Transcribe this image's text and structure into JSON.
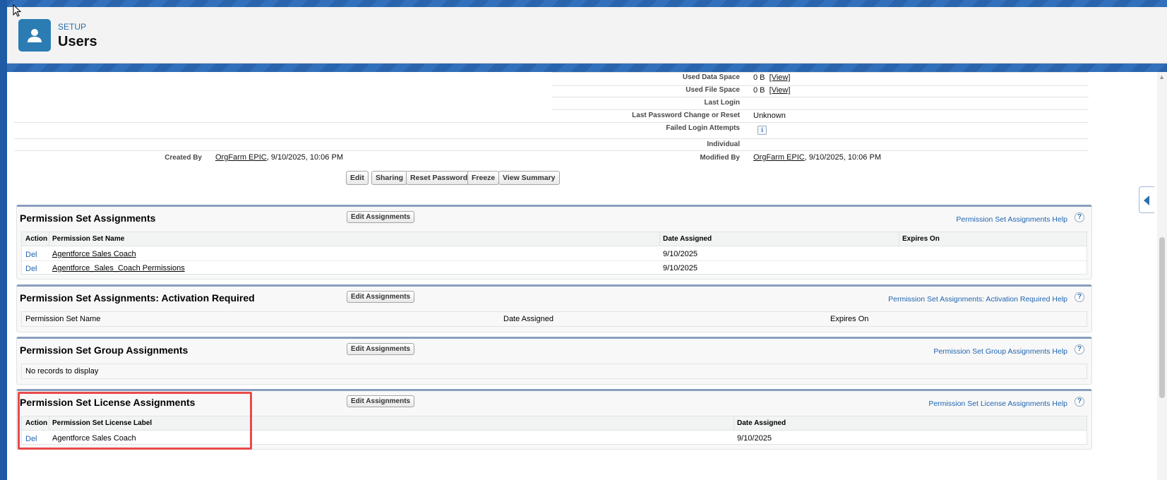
{
  "header": {
    "breadcrumb": "SETUP",
    "title": "Users"
  },
  "details": {
    "used_data_space": {
      "label": "Used Data Space",
      "value": "0 B",
      "link": "[View]"
    },
    "used_file_space": {
      "label": "Used File Space",
      "value": "0 B",
      "link": "[View]"
    },
    "last_login": {
      "label": "Last Login",
      "value": ""
    },
    "last_password_change": {
      "label": "Last Password Change or Reset",
      "value": "Unknown"
    },
    "failed_login_attempts": {
      "label": "Failed Login Attempts",
      "info_icon": "i"
    },
    "individual": {
      "label": "Individual",
      "value": ""
    },
    "created_by": {
      "label": "Created By",
      "user": "OrgFarm EPIC",
      "date": ", 9/10/2025, 10:06 PM"
    },
    "modified_by": {
      "label": "Modified By",
      "user": "OrgFarm EPIC",
      "date": ", 9/10/2025, 10:06 PM"
    }
  },
  "buttons": {
    "edit": "Edit",
    "sharing": "Sharing",
    "reset_password": "Reset Password",
    "freeze": "Freeze",
    "view_summary": "View Summary"
  },
  "sections": {
    "psa": {
      "title": "Permission Set Assignments",
      "edit_button": "Edit Assignments",
      "help": "Permission Set Assignments Help",
      "columns": [
        "Action",
        "Permission Set Name",
        "Date Assigned",
        "Expires On"
      ],
      "rows": [
        {
          "action": "Del",
          "name": "Agentforce Sales Coach",
          "date": "9/10/2025",
          "expires": ""
        },
        {
          "action": "Del",
          "name": "Agentforce_Sales_Coach Permissions",
          "date": "9/10/2025",
          "expires": ""
        }
      ]
    },
    "psa_activation": {
      "title": "Permission Set Assignments: Activation Required",
      "edit_button": "Edit Assignments",
      "help": "Permission Set Assignments: Activation Required Help",
      "columns": [
        "Permission Set Name",
        "Date Assigned",
        "Expires On"
      ]
    },
    "psg": {
      "title": "Permission Set Group Assignments",
      "edit_button": "Edit Assignments",
      "help": "Permission Set Group Assignments Help",
      "empty": "No records to display"
    },
    "pslicense": {
      "title": "Permission Set License Assignments",
      "edit_button": "Edit Assignments",
      "help": "Permission Set License Assignments Help",
      "columns": [
        "Action",
        "Permission Set License Label",
        "Date Assigned"
      ],
      "rows": [
        {
          "action": "Del",
          "label": "Agentforce Sales Coach",
          "date": "9/10/2025"
        }
      ]
    }
  },
  "help_icon": "?",
  "colors": {
    "link_blue": "#2065b0",
    "header_icon": "#2b7cb3",
    "highlight": "#e84a4a"
  }
}
